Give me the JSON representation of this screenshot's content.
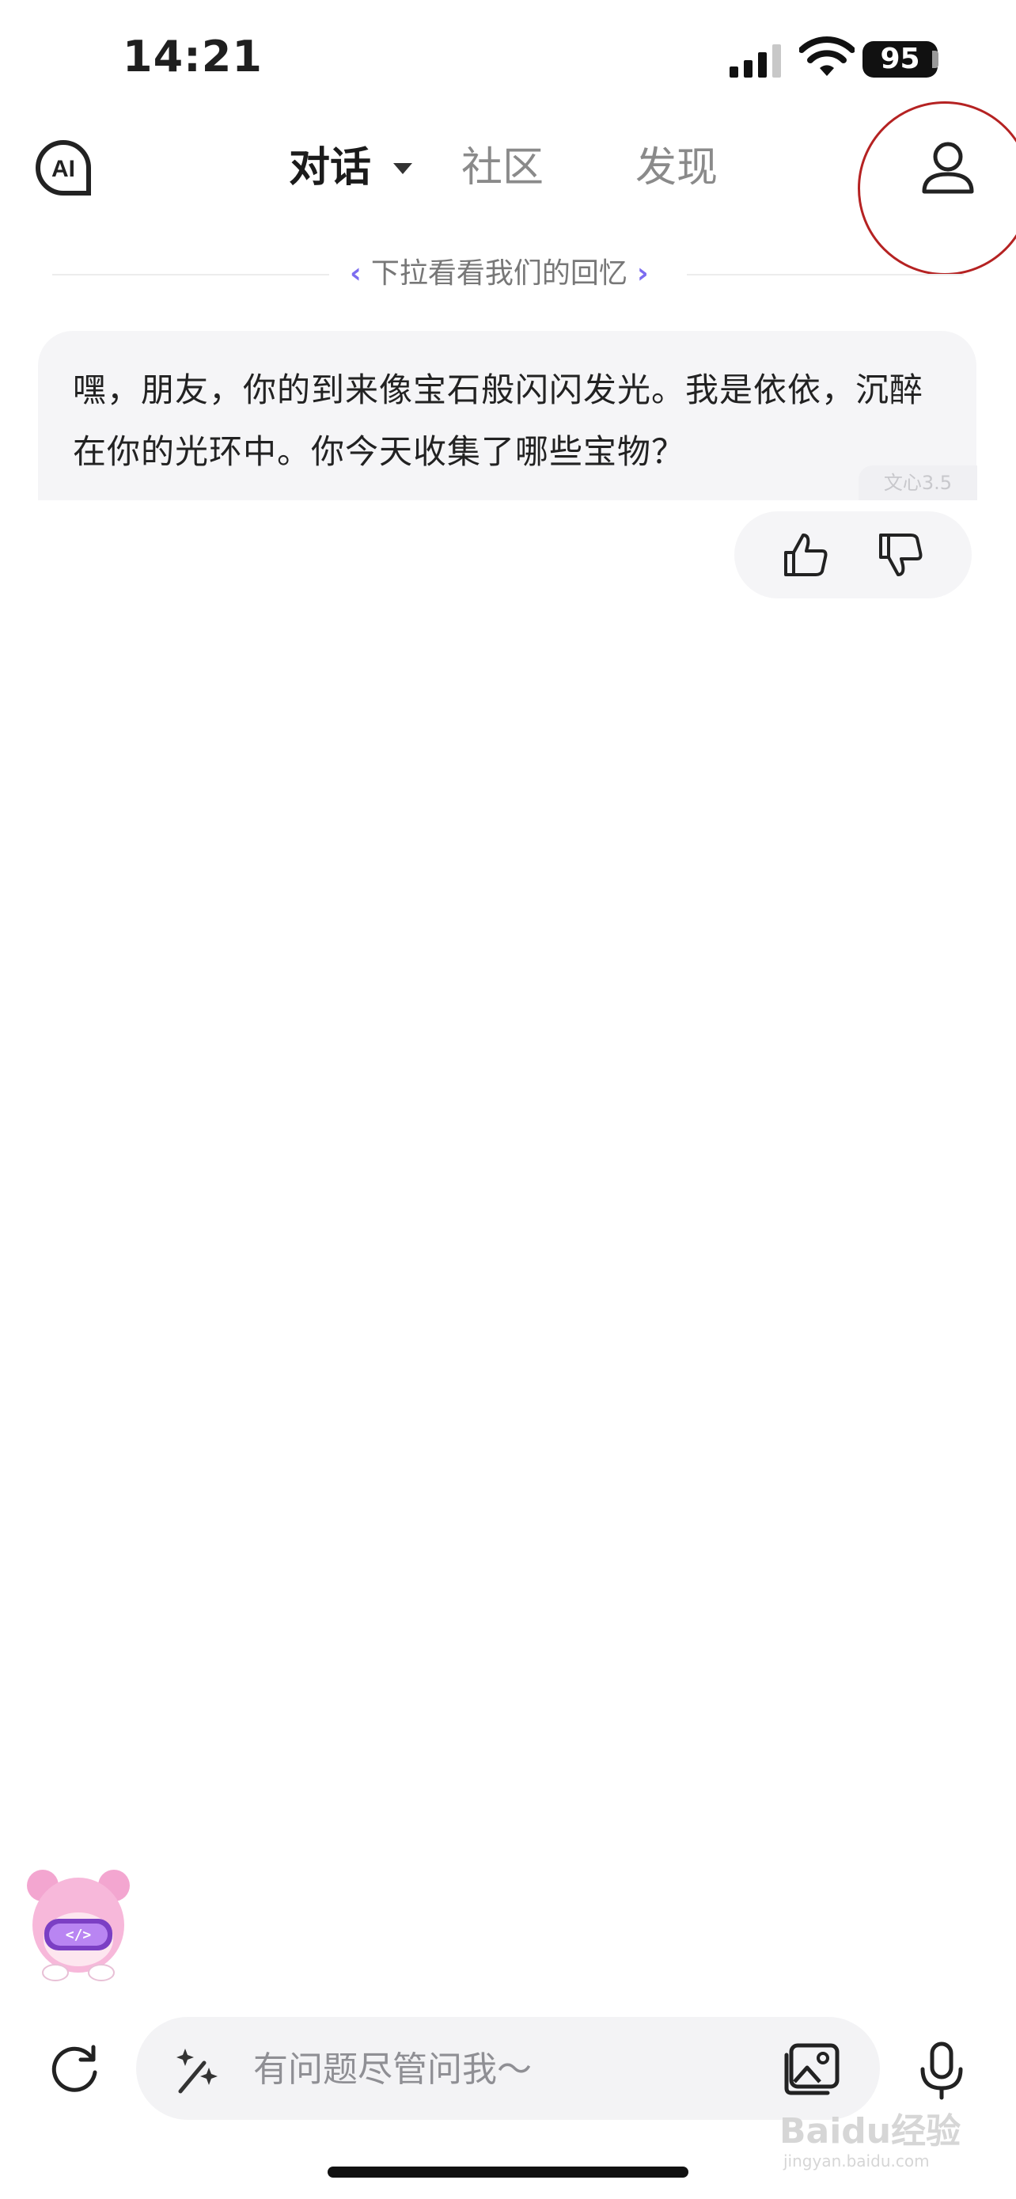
{
  "status_bar": {
    "time": "14:21",
    "battery": "95"
  },
  "header": {
    "logo_text": "AI",
    "tabs": [
      {
        "label": "对话",
        "active": true
      },
      {
        "label": "社区",
        "active": false
      },
      {
        "label": "发现",
        "active": false
      }
    ],
    "profile_icon": "person-icon"
  },
  "memory": {
    "label": "下拉看看我们的回忆",
    "left_chevron": "‹",
    "right_chevron": "›"
  },
  "message": {
    "text": "嘿，朋友，你的到来像宝石般闪闪发光。我是依依，沉醉在你的光环中。你今天收集了哪些宝物？",
    "model_tag": "文心3.5"
  },
  "feedback": {
    "like_icon": "thumbs-up-icon",
    "dislike_icon": "thumbs-down-icon"
  },
  "composer": {
    "placeholder": "有问题尽管问我～",
    "magic_icon": "sparkle-wand-icon",
    "image_icon": "image-icon",
    "mic_icon": "microphone-icon",
    "refresh_icon": "refresh-icon"
  },
  "watermark": {
    "brand": "Baidu经验",
    "url": "jingyan.baidu.com"
  },
  "colors": {
    "accent": "#7c6cf0",
    "bubble": "#f5f5f7",
    "annotation": "#b52222"
  }
}
